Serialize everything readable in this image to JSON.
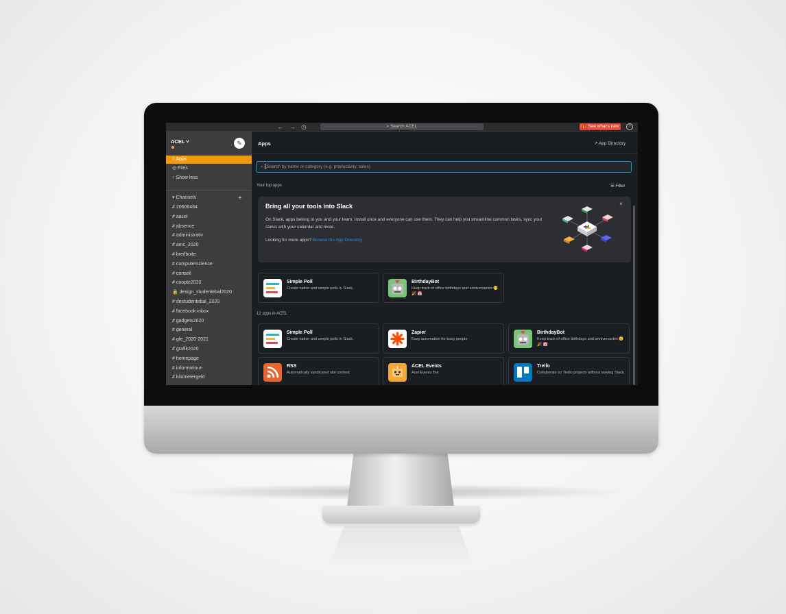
{
  "topbar": {
    "back": "←",
    "forward": "→",
    "history": "◷",
    "search_label": "Search ACEL",
    "whats_new": "See what's new",
    "help": "?"
  },
  "sidebar": {
    "workspace": "ACEL ˅",
    "compose_icon": "✎",
    "items": [
      {
        "label": "Apps",
        "icon": "apps-grid-icon"
      },
      {
        "label": "Files",
        "icon": "files-icon"
      },
      {
        "label": "Show less",
        "icon": "arrow-up-icon"
      }
    ],
    "channels_header": "Channels",
    "channels": [
      "# 20608484",
      "# aacel",
      "# absence",
      "# administrativ",
      "# amc_2020",
      "# breifboite",
      "# computerscience",
      "# conseil",
      "# coopte2020",
      "🔒 design_studentebal2020",
      "# destudentebal_2020",
      "# facebook-inbox",
      "# gadgets2020",
      "# general",
      "# gfe_2020-2021",
      "# grafik2020",
      "# homepage",
      "# informatioun",
      "# kilometergeld"
    ]
  },
  "main": {
    "title": "Apps",
    "app_directory": "App Directory",
    "search_placeholder": "Search by name or category (e.g. productivity, sales)",
    "top_apps_label": "Your top apps",
    "filter_label": "Filter",
    "banner": {
      "title": "Bring all your tools into Slack",
      "desc": "On Slack, apps belong to you and your team. Install once and everyone can use them. They can help you streamline common tasks, sync your status with your calendar and more.",
      "more_prefix": "Looking for more apps?",
      "more_link": "Browse the App Directory",
      "close": "×"
    },
    "top_apps": [
      {
        "name": "Simple Poll",
        "desc": "Create native and simple polls in Slack."
      },
      {
        "name": "BirthdayBot",
        "desc": "Keep track of office birthdays and anniversaries 😊 🎉 📅"
      }
    ],
    "all_apps_label": "12 apps in ACEL",
    "all_apps": [
      {
        "name": "Simple Poll",
        "desc": "Create native and simple polls in Slack."
      },
      {
        "name": "Zapier",
        "desc": "Easy automation for busy people"
      },
      {
        "name": "BirthdayBot",
        "desc": "Keep track of office birthdays and anniversaries 😊 🎉 📅"
      },
      {
        "name": "RSS",
        "desc": "Automatically syndicated site content."
      },
      {
        "name": "ACEL Events",
        "desc": "Acel Events Bot"
      },
      {
        "name": "Trello",
        "desc": "Collaborate on Trello projects without leaving Slack."
      }
    ]
  },
  "colors": {
    "accent": "#f29a09",
    "sidebar_bg": "#3d3d3f",
    "main_bg": "#1a1d21",
    "link": "#1d9bd1",
    "whats_new_bg": "#e0483a"
  }
}
